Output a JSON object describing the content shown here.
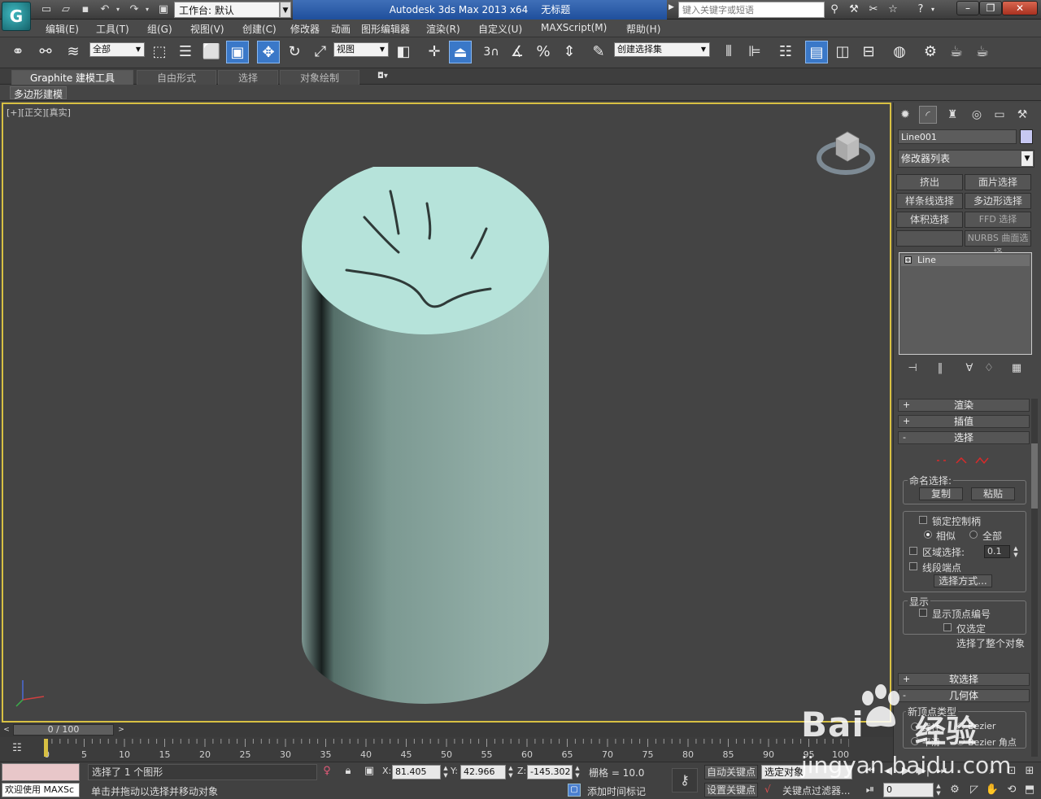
{
  "titlebar": {
    "workspace": "工作台: 默认",
    "app_name": "Autodesk 3ds Max  2013 x64",
    "doc_title": "无标题",
    "search_placeholder": "键入关键字或短语"
  },
  "menu": [
    "编辑(E)",
    "工具(T)",
    "组(G)",
    "视图(V)",
    "创建(C)",
    "修改器",
    "动画",
    "图形编辑器",
    "渲染(R)",
    "自定义(U)",
    "MAXScript(M)",
    "帮助(H)"
  ],
  "toolbar": {
    "selection_filter": "全部",
    "ref_coord": "视图",
    "named_selection": "创建选择集",
    "snap_label": "3"
  },
  "ribbon": {
    "tabs": [
      "Graphite 建模工具",
      "自由形式",
      "选择",
      "对象绘制"
    ],
    "subtab": "多边形建模"
  },
  "viewport": {
    "label": "[+][正交][真实]"
  },
  "command_panel": {
    "object_name": "Line001",
    "object_color": "#c7c8f2",
    "modifier_list": "修改器列表",
    "modifier_buttons": [
      "挤出",
      "面片选择",
      "样条线选择",
      "多边形选择",
      "体积选择",
      "FFD 选择",
      "",
      "NURBS 曲面选择"
    ],
    "stack_item": "Line",
    "rollouts": {
      "render": "渲染",
      "interp": "插值",
      "select": "选择",
      "soft": "软选择",
      "geometry": "几何体"
    },
    "named_sel_label": "命名选择:",
    "copy": "复制",
    "paste": "粘贴",
    "lock_handles": "锁定控制柄",
    "alike": "相似",
    "all": "全部",
    "area_select": "区域选择:",
    "area_value": "0.1",
    "segment_end": "线段端点",
    "select_by": "选择方式...",
    "display_label": "显示",
    "show_vertex_numbers": "显示顶点编号",
    "selected_only": "仅选定",
    "selected_whole": "选择了整个对象",
    "new_vertex_type": "新顶点类型",
    "linear": "线性",
    "bezier": "Bezier",
    "smooth": "平滑",
    "bezier_corner": "Bezier 角点"
  },
  "timeline": {
    "frame_display": "0 / 100",
    "ticks": [
      "0",
      "5",
      "10",
      "15",
      "20",
      "25",
      "30",
      "35",
      "40",
      "45",
      "50",
      "55",
      "60",
      "65",
      "70",
      "75",
      "80",
      "85",
      "90",
      "95",
      "100"
    ]
  },
  "status": {
    "welcome": "欢迎使用 MAXSc",
    "selection_info": "选择了 1 个图形",
    "prompt": "单击并拖动以选择并移动对象",
    "x_label": "X:",
    "x": "81.405",
    "y_label": "Y:",
    "y": "42.966",
    "z_label": "Z:",
    "z": "-145.302",
    "grid": "栅格 = 10.0",
    "auto_key": "自动关键点",
    "set_key": "设置关键点",
    "key_target": "选定对象",
    "key_filters": "关键点过滤器...",
    "add_time_tag": "添加时间标记",
    "frame": "0"
  },
  "watermark": {
    "brand_left": "Bai",
    "brand_right": "经验",
    "url": "jingyan.baidu.com"
  }
}
